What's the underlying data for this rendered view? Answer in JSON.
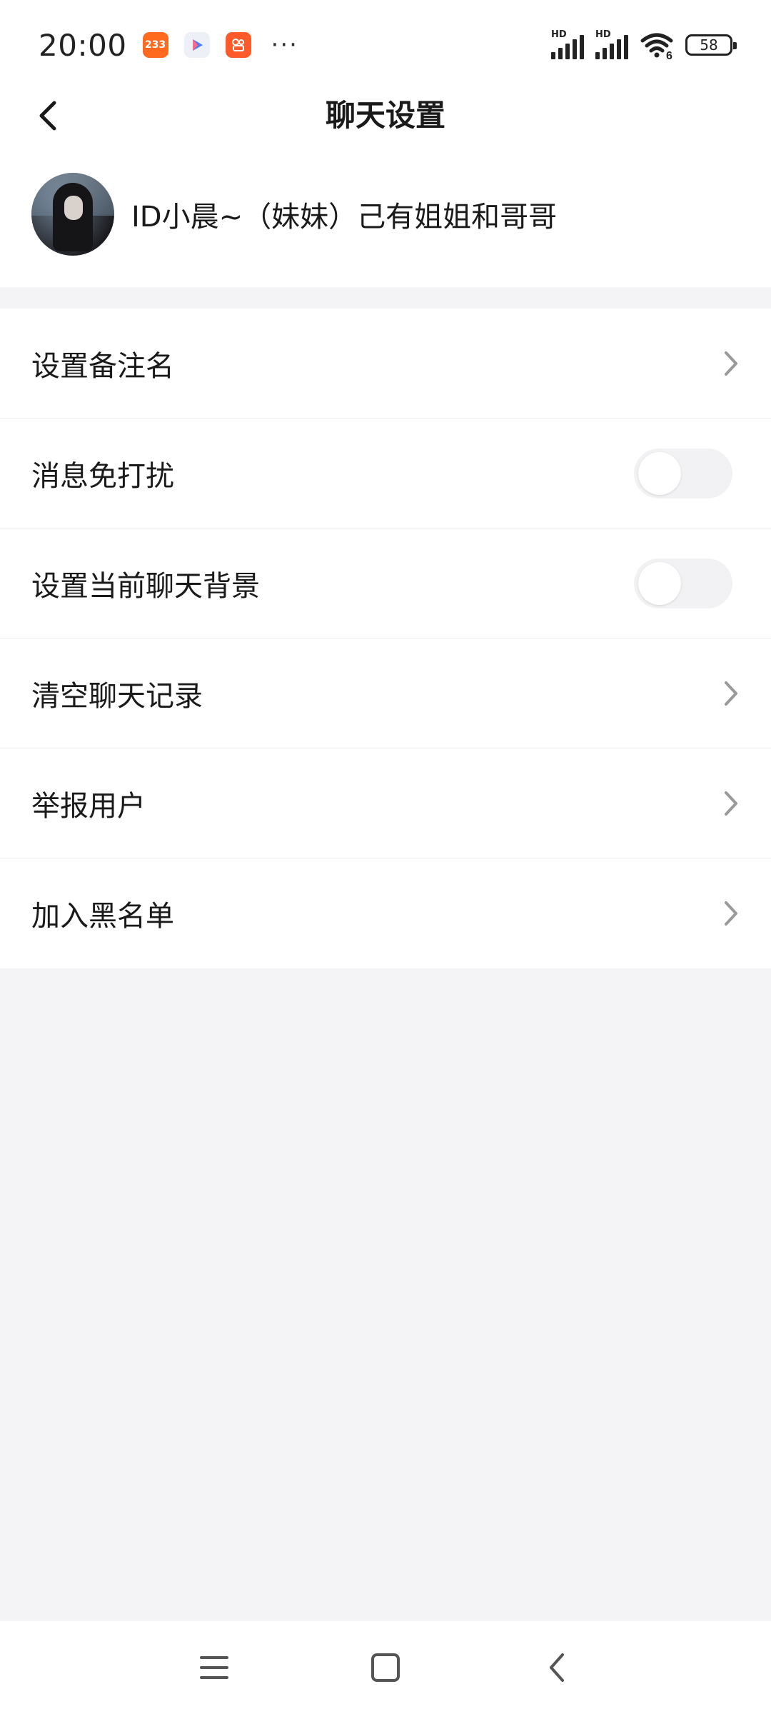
{
  "status_bar": {
    "time": "20:00",
    "app_badges": [
      {
        "icon": "app-233-icon",
        "label": "233",
        "color": "#ff6a1e"
      },
      {
        "icon": "video-play-icon",
        "label": "",
        "color": "#eef0f7"
      },
      {
        "icon": "kuaishou-icon",
        "label": "",
        "color": "#ff5a2a"
      }
    ],
    "more": "···",
    "signal_1_label": "HD",
    "signal_2_label": "HD",
    "wifi_label": "6",
    "battery": "58"
  },
  "header": {
    "title": "聊天设置",
    "back_icon": "chevron-left-icon"
  },
  "profile": {
    "name": "ID小晨~（妹妹）己有姐姐和哥哥"
  },
  "settings": [
    {
      "label": "设置备注名",
      "control": "chevron"
    },
    {
      "label": "消息免打扰",
      "control": "toggle",
      "on": false
    },
    {
      "label": "设置当前聊天背景",
      "control": "toggle",
      "on": false
    },
    {
      "label": "清空聊天记录",
      "control": "chevron"
    },
    {
      "label": "举报用户",
      "control": "chevron"
    },
    {
      "label": "加入黑名单",
      "control": "chevron"
    }
  ],
  "nav_bar": {
    "buttons": [
      "menu-icon",
      "home-icon",
      "back-icon"
    ]
  },
  "colors": {
    "background": "#f4f3f6",
    "surface": "#ffffff",
    "text": "#1a1a1a",
    "chevron": "#9a9a9a",
    "toggle_off": "#f2f2f4"
  }
}
